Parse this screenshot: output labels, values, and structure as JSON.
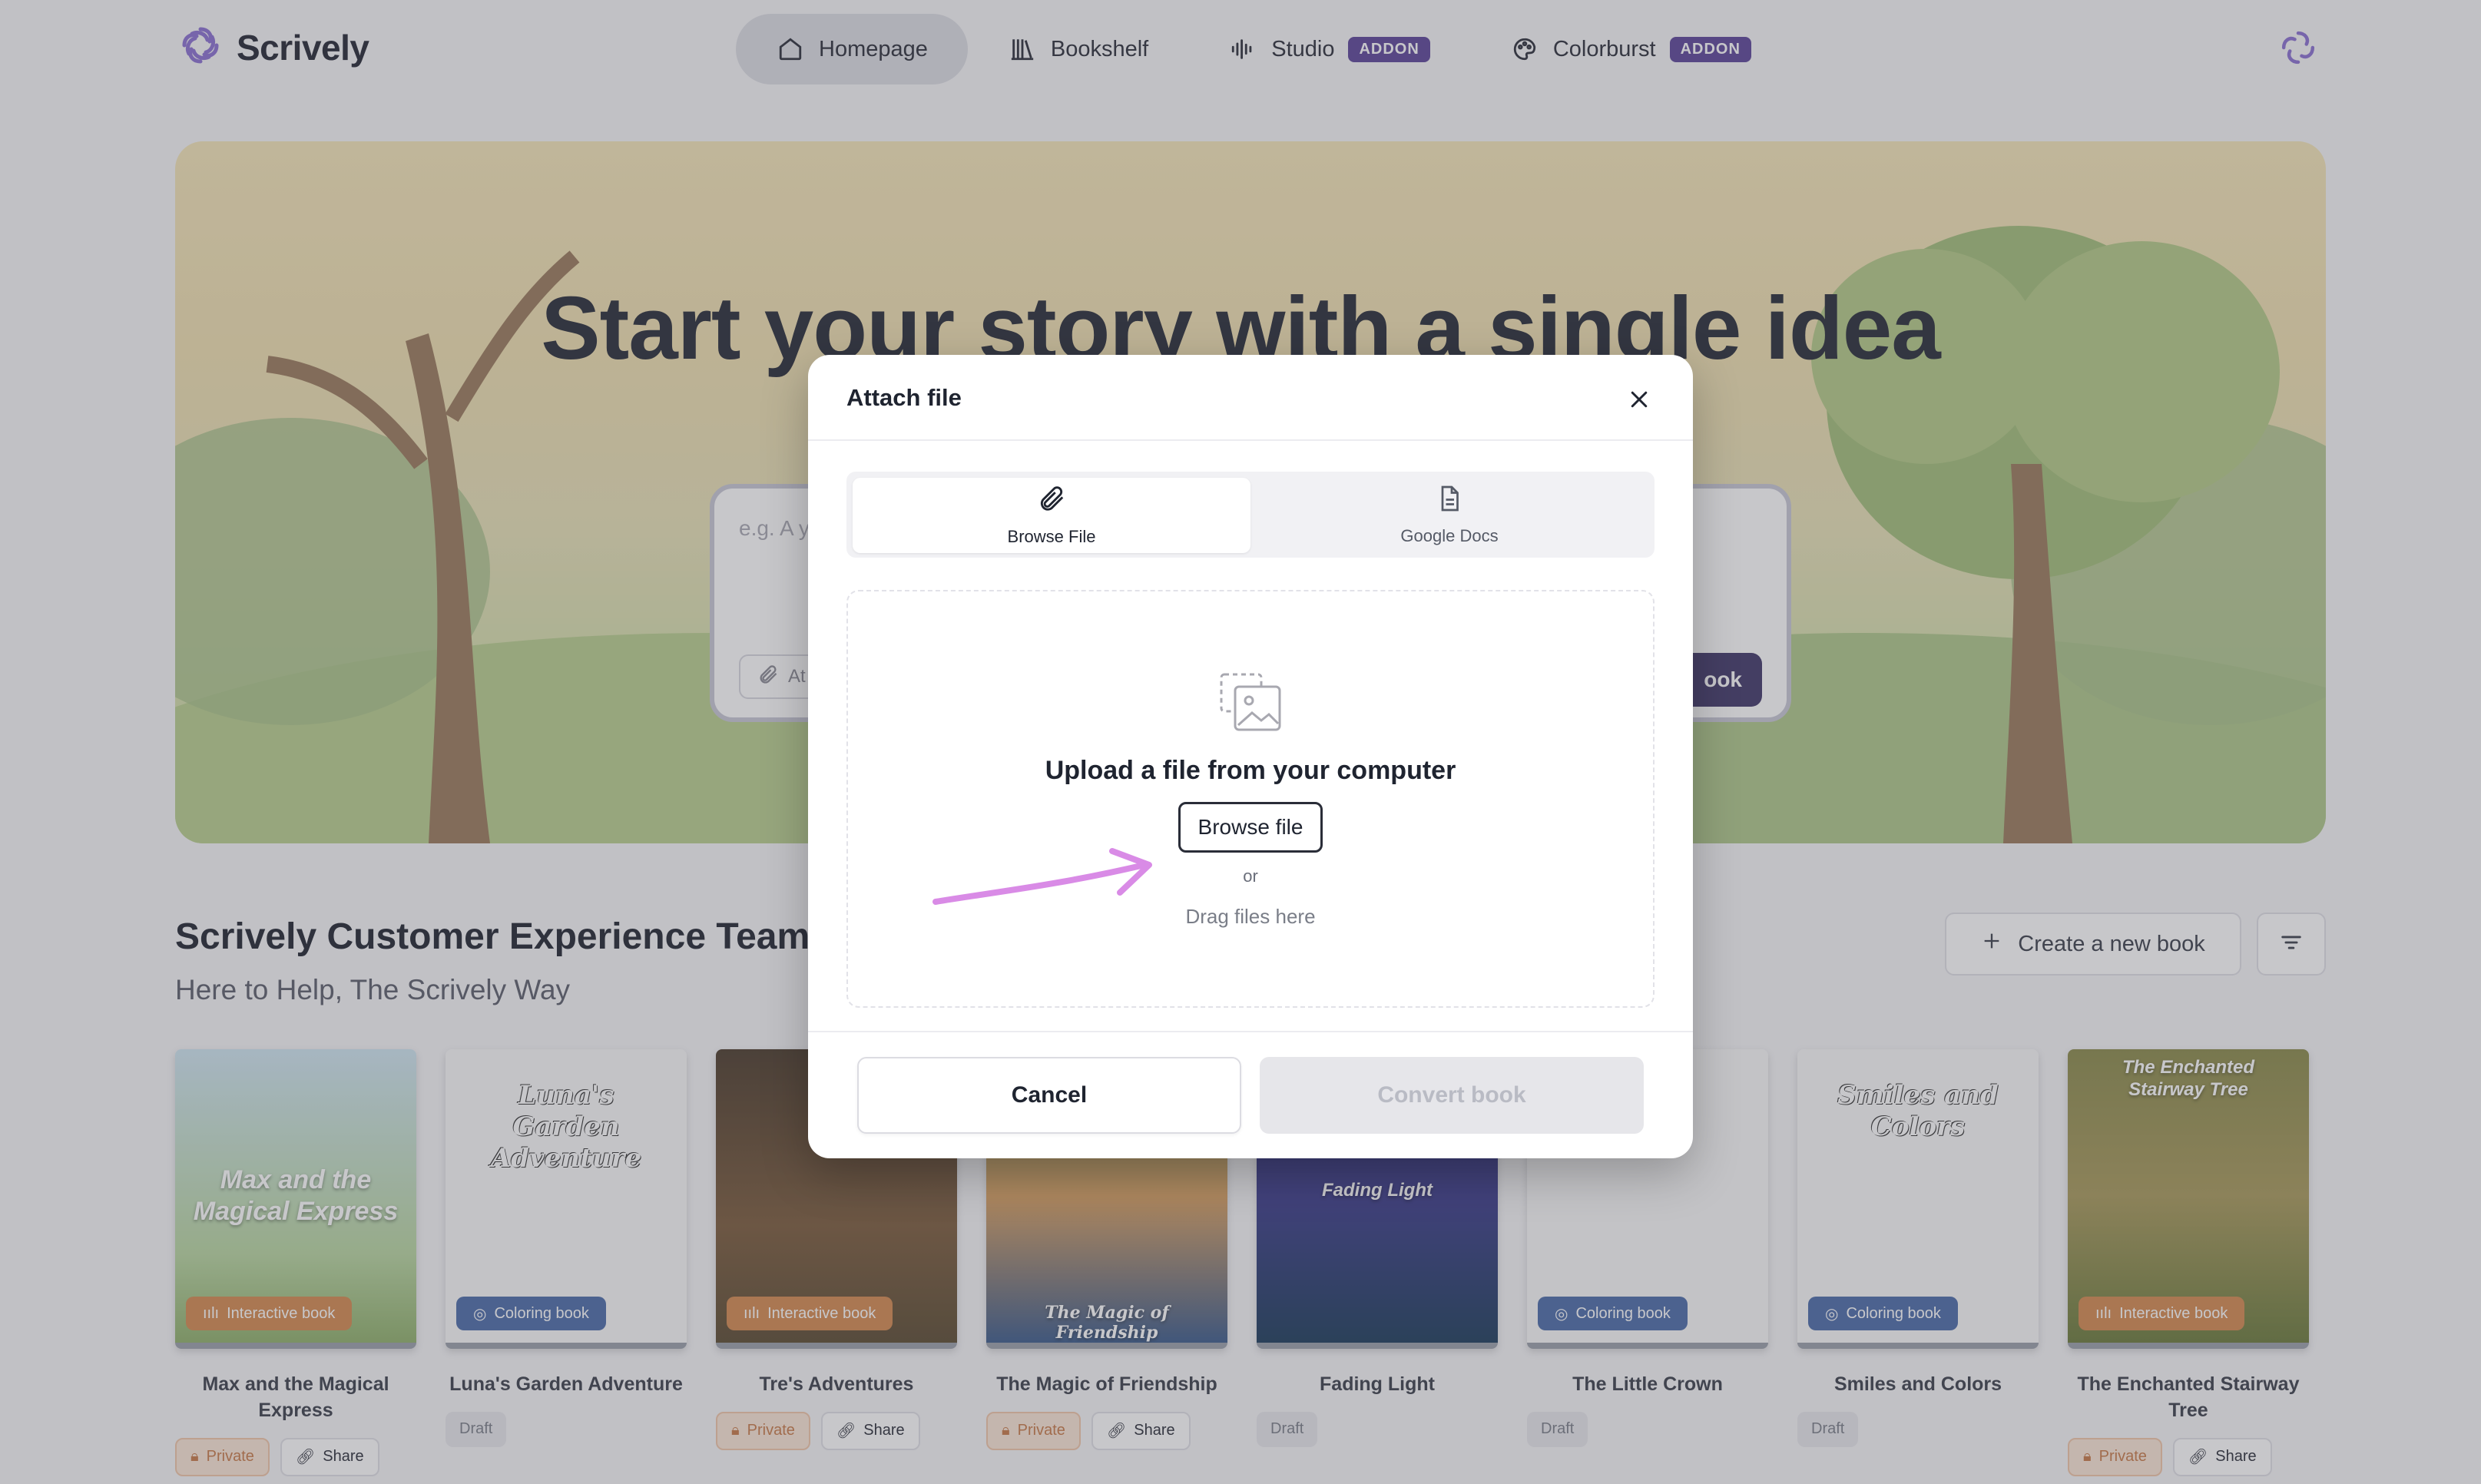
{
  "app": {
    "name": "Scrively"
  },
  "nav": [
    {
      "label": "Homepage",
      "icon": "home-icon",
      "active": true
    },
    {
      "label": "Bookshelf",
      "icon": "bookshelf-icon"
    },
    {
      "label": "Studio",
      "icon": "audio-wave-icon",
      "badge": "ADDON"
    },
    {
      "label": "Colorburst",
      "icon": "palette-icon",
      "badge": "ADDON"
    }
  ],
  "hero": {
    "title": "Start your story with a single idea",
    "prompt_placeholder": "e.g. A y",
    "attach_label": "At",
    "create_label": "ook"
  },
  "section": {
    "title": "Scrively Customer Experience Team",
    "subtitle": "Here to Help, The Scrively Way",
    "new_book_label": "Create a new book"
  },
  "books": [
    {
      "title": "Max and the Magical Express",
      "cover_text": "Max and the Magical Express",
      "type": "Interactive book",
      "chips": [
        "Private",
        "Share"
      ]
    },
    {
      "title": "Luna's Garden Adventure",
      "cover_text": "Luna's Garden Adventure",
      "type": "Coloring book",
      "chips": [
        "Draft"
      ]
    },
    {
      "title": "Tre's Adventures",
      "cover_text": "",
      "type": "Interactive book",
      "chips": [
        "Private",
        "Share"
      ]
    },
    {
      "title": "The Magic of Friendship",
      "cover_text": "The Magic of Friendship",
      "type": "",
      "chips": [
        "Private",
        "Share"
      ]
    },
    {
      "title": "Fading Light",
      "cover_text": "Fading Light",
      "type": "",
      "chips": [
        "Draft"
      ]
    },
    {
      "title": "The Little Crown",
      "cover_text": "",
      "type": "Coloring book",
      "chips": [
        "Draft"
      ]
    },
    {
      "title": "Smiles and Colors",
      "cover_text": "Smiles and Colors",
      "type": "Coloring book",
      "chips": [
        "Draft"
      ]
    },
    {
      "title": "The Enchanted Stairway Tree",
      "cover_text": "The Enchanted Stairway Tree",
      "type": "Interactive book",
      "chips": [
        "Private",
        "Share"
      ]
    }
  ],
  "modal": {
    "title": "Attach file",
    "tabs": [
      {
        "label": "Browse File",
        "icon": "paperclip-icon",
        "active": true
      },
      {
        "label": "Google Docs",
        "icon": "document-icon"
      }
    ],
    "upload_title": "Upload a file from your computer",
    "browse_label": "Browse file",
    "or_label": "or",
    "drag_label": "Drag files here",
    "cancel_label": "Cancel",
    "convert_label": "Convert book"
  },
  "colors": {
    "accent": "#5a4398",
    "brand_purple": "#8a6fd1",
    "annotation_arrow": "#d98be6"
  }
}
